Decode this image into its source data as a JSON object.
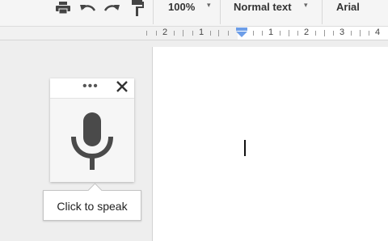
{
  "toolbar": {
    "icons": [
      "print-icon",
      "undo-icon",
      "redo-icon",
      "paint-format-icon"
    ],
    "zoom": "100%",
    "style": "Normal text",
    "font": "Arial",
    "caret": "▾"
  },
  "ruler": {
    "numbers": [
      "2",
      "1",
      "1",
      "2",
      "3",
      "4"
    ]
  },
  "voice_typing": {
    "more_label": "•••",
    "close_label": "✕",
    "tooltip": "Click to speak"
  },
  "colors": {
    "toolbar_bg": "#f5f5f5",
    "workspace_bg": "#eeeeee",
    "indent_marker": "#6d9ee8",
    "mic": "#4a4a4a"
  }
}
